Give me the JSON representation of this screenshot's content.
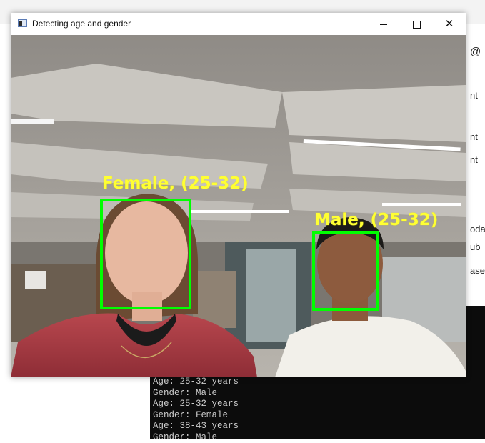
{
  "window": {
    "title": "Detecting age and gender",
    "minimize_icon": "minimize-icon",
    "maximize_icon": "maximize-icon",
    "close_icon": "close-icon"
  },
  "detections": [
    {
      "label": "Female, (25-32)",
      "color": "#00ff00",
      "label_color": "#ffff33"
    },
    {
      "label": "Male, (25-32)",
      "color": "#00ff00",
      "label_color": "#ffff33"
    }
  ],
  "console": {
    "lines": [
      "Age: 25-32 years",
      "Gender: Male",
      "Age: 25-32 years",
      "Gender: Female",
      "Age: 38-43 years",
      "Gender: Male"
    ]
  },
  "background_app": {
    "fragments": [
      "@",
      "nt",
      "nt",
      "nt",
      "oda",
      "ub",
      "ase"
    ]
  }
}
